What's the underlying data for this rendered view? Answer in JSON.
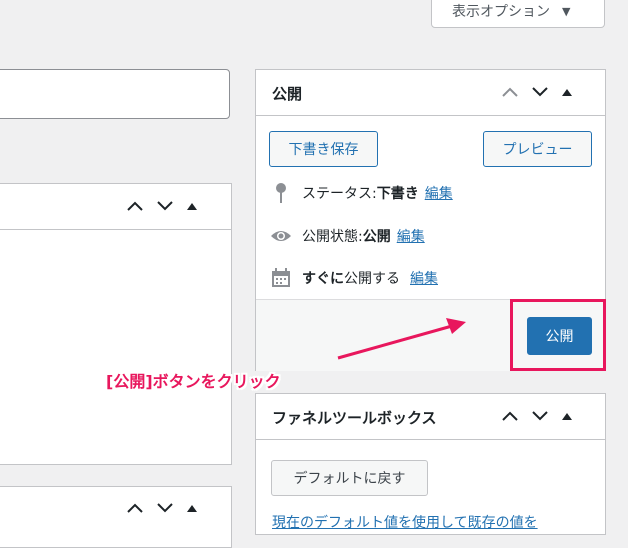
{
  "screen_options": {
    "label": "表示オプション",
    "arrow": "▼"
  },
  "publish_box": {
    "title": "公開",
    "save_draft": "下書き保存",
    "preview": "プレビュー",
    "status": {
      "label": "ステータス: ",
      "value": "下書き",
      "edit": "編集"
    },
    "visibility": {
      "label": "公開状態: ",
      "value": "公開",
      "edit": "編集"
    },
    "schedule": {
      "value": "すぐに",
      "label": "公開する",
      "edit": "編集"
    },
    "publish_button": "公開"
  },
  "funnel_box": {
    "title": "ファネルツールボックス",
    "reset_button": "デフォルトに戻す",
    "link_text": "現在のデフォルト値を使用して既存の値を"
  },
  "annotation": {
    "text": "[公開]ボタンをクリック",
    "color": "#e8175d"
  },
  "colors": {
    "accent": "#2271b1",
    "highlight": "#e8175d"
  }
}
